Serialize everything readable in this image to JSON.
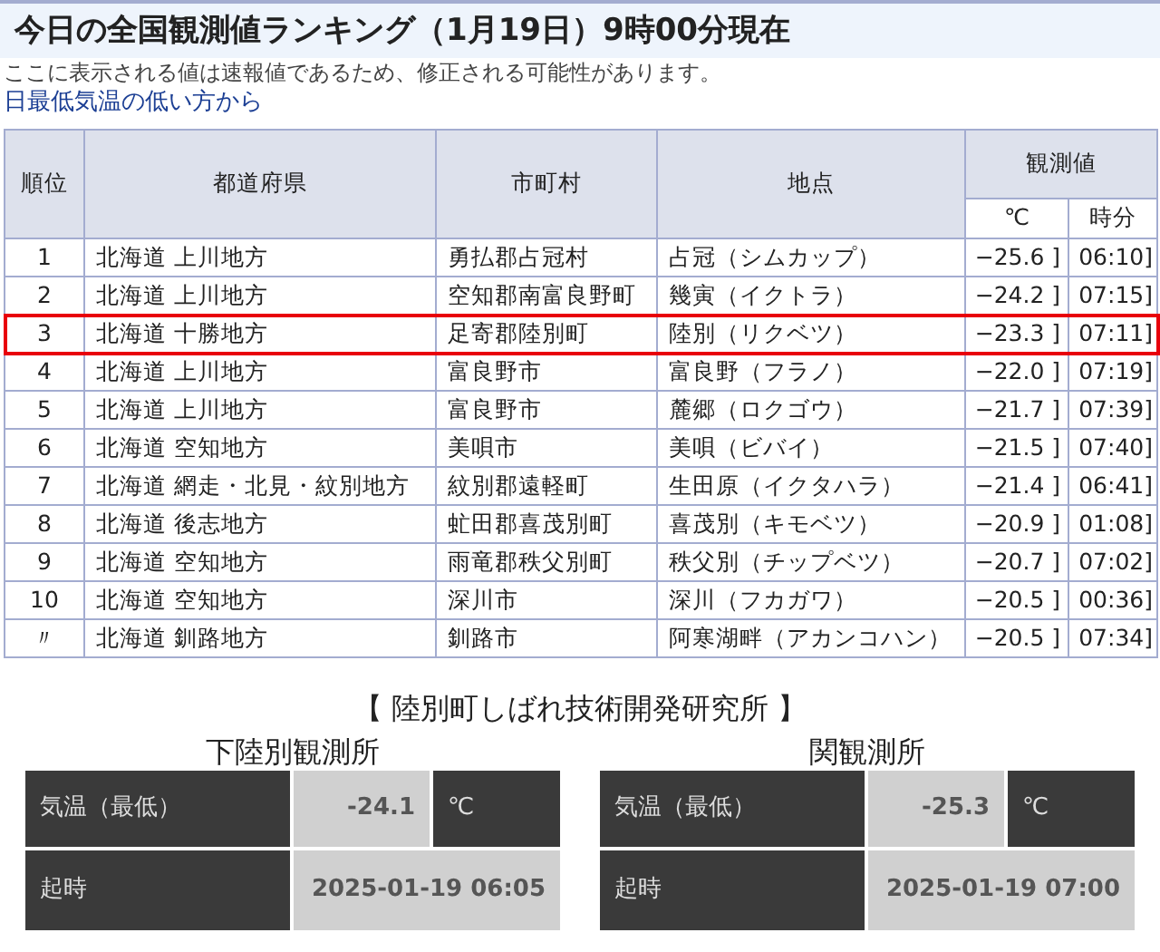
{
  "title": "今日の全国観測値ランキング（1月19日）9時00分現在",
  "notice": "ここに表示される値は速報値であるため、修正される可能性があります。",
  "subtitle": "日最低気温の低い方から",
  "table": {
    "columns": [
      "順位",
      "都道府県",
      "市町村",
      "地点",
      "観測値"
    ],
    "subcolumns": [
      "℃",
      "時分"
    ],
    "rows": [
      {
        "rank": "1",
        "prefecture": "北海道 上川地方",
        "city": "勇払郡占冠村",
        "point": "占冠（シムカップ）",
        "value": "−25.6 ]",
        "time": "06:10]",
        "selected": false
      },
      {
        "rank": "2",
        "prefecture": "北海道 上川地方",
        "city": "空知郡南富良野町",
        "point": "幾寅（イクトラ）",
        "value": "−24.2 ]",
        "time": "07:15]",
        "selected": false
      },
      {
        "rank": "3",
        "prefecture": "北海道 十勝地方",
        "city": "足寄郡陸別町",
        "point": "陸別（リクベツ）",
        "value": "−23.3 ]",
        "time": "07:11]",
        "selected": true
      },
      {
        "rank": "4",
        "prefecture": "北海道 上川地方",
        "city": "富良野市",
        "point": "富良野（フラノ）",
        "value": "−22.0 ]",
        "time": "07:19]",
        "selected": false
      },
      {
        "rank": "5",
        "prefecture": "北海道 上川地方",
        "city": "富良野市",
        "point": "麓郷（ロクゴウ）",
        "value": "−21.7 ]",
        "time": "07:39]",
        "selected": false
      },
      {
        "rank": "6",
        "prefecture": "北海道 空知地方",
        "city": "美唄市",
        "point": "美唄（ビバイ）",
        "value": "−21.5 ]",
        "time": "07:40]",
        "selected": false
      },
      {
        "rank": "7",
        "prefecture": "北海道 網走・北見・紋別地方",
        "city": "紋別郡遠軽町",
        "point": "生田原（イクタハラ）",
        "value": "−21.4 ]",
        "time": "06:41]",
        "selected": false
      },
      {
        "rank": "8",
        "prefecture": "北海道 後志地方",
        "city": "虻田郡喜茂別町",
        "point": "喜茂別（キモベツ）",
        "value": "−20.9 ]",
        "time": "01:08]",
        "selected": false
      },
      {
        "rank": "9",
        "prefecture": "北海道 空知地方",
        "city": "雨竜郡秩父別町",
        "point": "秩父別（チップベツ）",
        "value": "−20.7 ]",
        "time": "07:02]",
        "selected": false
      },
      {
        "rank": "10",
        "prefecture": "北海道 空知地方",
        "city": "深川市",
        "point": "深川（フカガワ）",
        "value": "−20.5 ]",
        "time": "00:36]",
        "selected": false
      },
      {
        "rank": "〃",
        "prefecture": "北海道 釧路地方",
        "city": "釧路市",
        "point": "阿寒湖畔（アカンコハン）",
        "value": "−20.5 ]",
        "time": "07:34]",
        "selected": false
      }
    ]
  },
  "institute": {
    "title": "【 陸別町しばれ技術開発研究所 】",
    "stations": [
      {
        "name": "下陸別観測所",
        "temp_label": "気温（最低）",
        "temp": "-24.1",
        "unit": "℃",
        "time_label": "起時",
        "time": "2025-01-19 06:05"
      },
      {
        "name": "関観測所",
        "temp_label": "気温（最低）",
        "temp": "-25.3",
        "unit": "℃",
        "time_label": "起時",
        "time": "2025-01-19 07:00"
      }
    ]
  }
}
